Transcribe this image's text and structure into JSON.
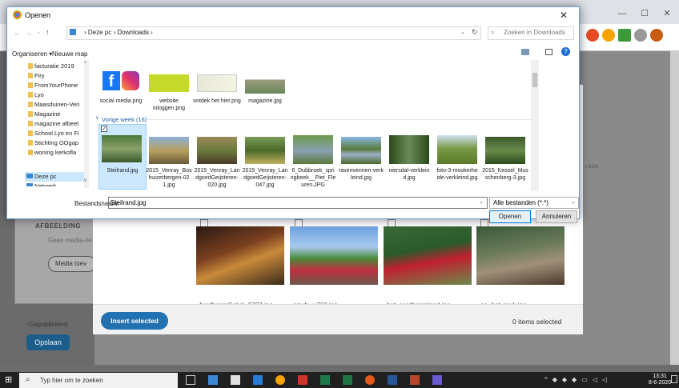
{
  "dialog": {
    "title": "Openen",
    "breadcrumb_root": "Deze pc",
    "breadcrumb_folder": "Downloads",
    "search_placeholder": "Zoeken in Downloads",
    "organise": "Organiseren ▾",
    "new_folder": "Nieuwe map",
    "nav_items": [
      "facturatie 2019",
      "Firy",
      "FromYourPhone",
      "Lyo",
      "Maasduinen-Ven",
      "Magazine",
      "magazine afbeel",
      "School Lyo en Fi",
      "Stichting OOgap",
      "woning kerkofla",
      "Deze pc",
      "Netwerk"
    ],
    "files_top": [
      {
        "label": "social media.png"
      },
      {
        "label": "website inloggen.png"
      },
      {
        "label": "ontdek het hier.png"
      },
      {
        "label": "magazine.jpg"
      }
    ],
    "group_header": "Vorige week (16)",
    "files_week": [
      {
        "label": "Steilrand.jpg"
      },
      {
        "label": "2015_Venray_Bos huizerbergen-02 1.jpg"
      },
      {
        "label": "2015_Venray_Lan dgoedGeijsteren- 020.jpg"
      },
      {
        "label": "2015_Venray_Lan dgoedGeijsteren- 047.jpg"
      },
      {
        "label": "6_Dubbroek_spri ngbeek__Piet_Fle uren.JPG"
      },
      {
        "label": "ravenvennen-verk leind.jpg"
      },
      {
        "label": "niersdal-verklein d.jpg"
      },
      {
        "label": "foto-3-mookerhe ide-verkleind.jpg"
      },
      {
        "label": "2015_Kessel_Mus schenberg-3.jpg"
      }
    ],
    "filename_label": "Bestandsnaam:",
    "filename_value": "Steilrand.jpg",
    "filter_value": "Alle bestanden (*.*)",
    "open_label": "Openen",
    "cancel_label": "Annuleren"
  },
  "wp": {
    "afbeelding": "AFBEELDING",
    "geen": "Geen media-ite",
    "media_toev": "Media toev",
    "gepubliceerd": "Gepubliceerd",
    "opslaan": "Opslaan",
    "side_text": "t kort."
  },
  "media": {
    "insert_label": "Insert selected",
    "items_selected": "0 items selected",
    "grid_labels": [
      "AardbeienGeluk_0737.jpg",
      "anwb_w760.jpg",
      "het_aardbeienland.jpg",
      "op_het_park.jpg"
    ]
  },
  "taskbar": {
    "search_placeholder": "Typ hier om te zoeken",
    "time": "13:31",
    "date": "8-6-2020"
  },
  "colors": {
    "accent": "#2271b1",
    "selection": "#cce8ff",
    "taskbar": "#202020"
  }
}
